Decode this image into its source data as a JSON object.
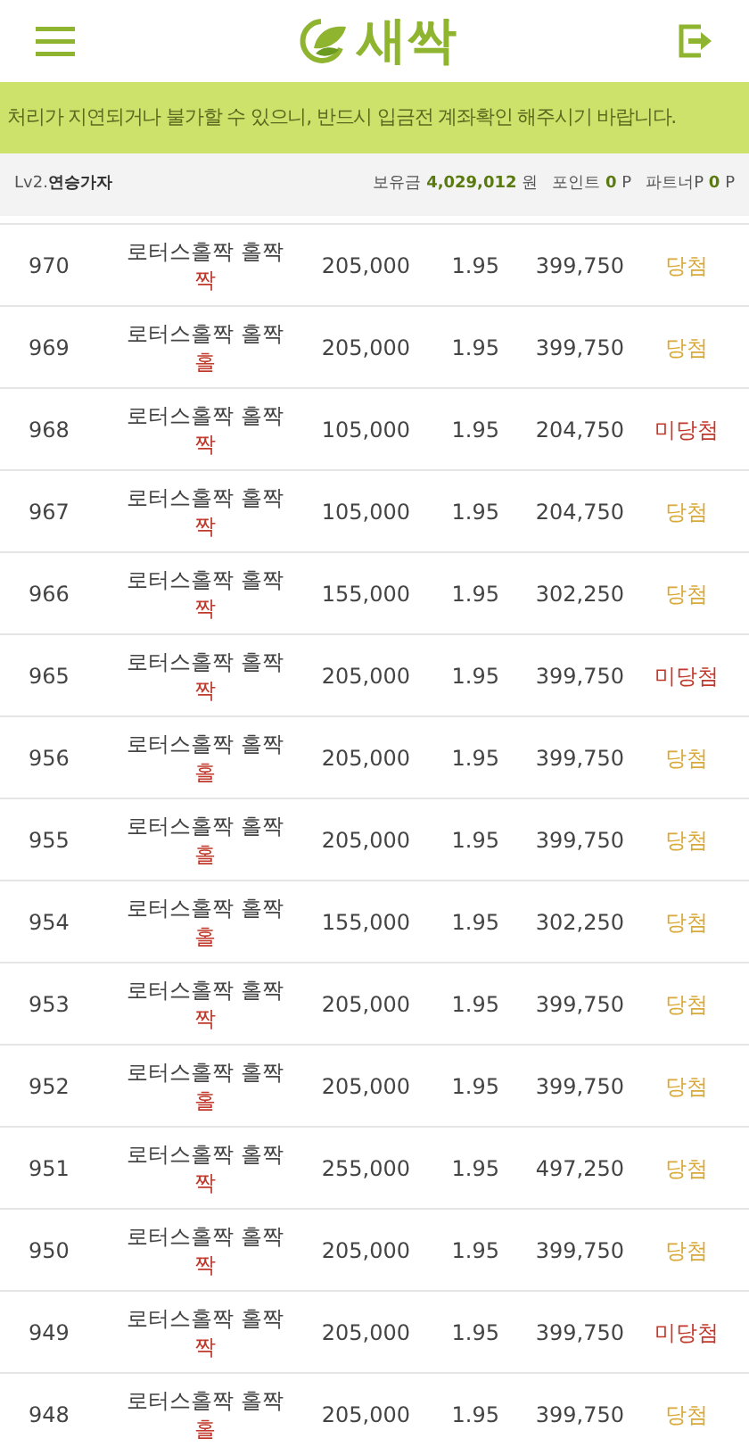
{
  "header": {
    "logo_text": "새싹"
  },
  "notice": "처리가 지연되거나 불가할 수 있으니, 반드시 입금전 계좌확인 해주시기 바랍니다.",
  "user": {
    "level": "Lv2.",
    "name": "연승가자",
    "balance_label": "보유금",
    "balance": "4,029,012",
    "balance_unit": "원",
    "point_label": "포인트",
    "point": "0",
    "point_unit": "P",
    "partner_label": "파트너P",
    "partner": "0",
    "partner_unit": "P"
  },
  "bets": [
    {
      "no": "970",
      "game": "로터스홀짝 홀짝",
      "pick": "짝",
      "amount": "205,000",
      "odds": "1.95",
      "payout": "399,750",
      "result": "당첨",
      "won": true
    },
    {
      "no": "969",
      "game": "로터스홀짝 홀짝",
      "pick": "홀",
      "amount": "205,000",
      "odds": "1.95",
      "payout": "399,750",
      "result": "당첨",
      "won": true
    },
    {
      "no": "968",
      "game": "로터스홀짝 홀짝",
      "pick": "짝",
      "amount": "105,000",
      "odds": "1.95",
      "payout": "204,750",
      "result": "미당첨",
      "won": false
    },
    {
      "no": "967",
      "game": "로터스홀짝 홀짝",
      "pick": "짝",
      "amount": "105,000",
      "odds": "1.95",
      "payout": "204,750",
      "result": "당첨",
      "won": true
    },
    {
      "no": "966",
      "game": "로터스홀짝 홀짝",
      "pick": "짝",
      "amount": "155,000",
      "odds": "1.95",
      "payout": "302,250",
      "result": "당첨",
      "won": true
    },
    {
      "no": "965",
      "game": "로터스홀짝 홀짝",
      "pick": "짝",
      "amount": "205,000",
      "odds": "1.95",
      "payout": "399,750",
      "result": "미당첨",
      "won": false
    },
    {
      "no": "956",
      "game": "로터스홀짝 홀짝",
      "pick": "홀",
      "amount": "205,000",
      "odds": "1.95",
      "payout": "399,750",
      "result": "당첨",
      "won": true
    },
    {
      "no": "955",
      "game": "로터스홀짝 홀짝",
      "pick": "홀",
      "amount": "205,000",
      "odds": "1.95",
      "payout": "399,750",
      "result": "당첨",
      "won": true
    },
    {
      "no": "954",
      "game": "로터스홀짝 홀짝",
      "pick": "홀",
      "amount": "155,000",
      "odds": "1.95",
      "payout": "302,250",
      "result": "당첨",
      "won": true
    },
    {
      "no": "953",
      "game": "로터스홀짝 홀짝",
      "pick": "짝",
      "amount": "205,000",
      "odds": "1.95",
      "payout": "399,750",
      "result": "당첨",
      "won": true
    },
    {
      "no": "952",
      "game": "로터스홀짝 홀짝",
      "pick": "홀",
      "amount": "205,000",
      "odds": "1.95",
      "payout": "399,750",
      "result": "당첨",
      "won": true
    },
    {
      "no": "951",
      "game": "로터스홀짝 홀짝",
      "pick": "짝",
      "amount": "255,000",
      "odds": "1.95",
      "payout": "497,250",
      "result": "당첨",
      "won": true
    },
    {
      "no": "950",
      "game": "로터스홀짝 홀짝",
      "pick": "짝",
      "amount": "205,000",
      "odds": "1.95",
      "payout": "399,750",
      "result": "당첨",
      "won": true
    },
    {
      "no": "949",
      "game": "로터스홀짝 홀짝",
      "pick": "짝",
      "amount": "205,000",
      "odds": "1.95",
      "payout": "399,750",
      "result": "미당첨",
      "won": false
    },
    {
      "no": "948",
      "game": "로터스홀짝 홀짝",
      "pick": "홀",
      "amount": "205,000",
      "odds": "1.95",
      "payout": "399,750",
      "result": "당첨",
      "won": true
    }
  ]
}
